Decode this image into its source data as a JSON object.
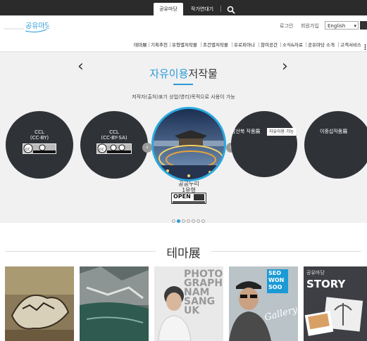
{
  "topbar": {
    "tabs": [
      {
        "label": "공유마당"
      },
      {
        "label": "작가연대기"
      }
    ]
  },
  "header": {
    "logo": {
      "text": "공유마당"
    },
    "util": {
      "login": "로그인",
      "signup": "회원가입",
      "language": "English"
    },
    "nav": [
      "테마展",
      "기획추천",
      "유형별저작물",
      "조건별저작물",
      "유로피아나",
      "참여공간",
      "소식&자료",
      "공유마당 소개",
      "고객서비스"
    ]
  },
  "hero": {
    "title_blue": "자유이용",
    "title_rest": "저작물",
    "subtitle": "저작자(출처)표기 상업(영리)목적으로 사용이 가능",
    "cards": [
      {
        "label_line1": "CCL",
        "label_line2": "(CC-BY)"
      },
      {
        "label_line1": "CCL",
        "label_line2": "(CC-BY-SA)"
      }
    ],
    "center": {
      "label_line1": "공공누리",
      "label_line2": "1유형",
      "badge": "OPEN"
    },
    "right_cards": [
      {
        "label": "남산북 작품展",
        "tag": "자유이용 가능"
      },
      {
        "label": "이중섭작품展"
      }
    ],
    "slide_count": 7,
    "active_slide": 1
  },
  "theme": {
    "title": "테마展",
    "thumbs": [
      {
        "alt": "painting"
      },
      {
        "alt": "landscape"
      },
      {
        "lines": [
          "PHOTO",
          "GRAPHER",
          "NAM",
          "SANG",
          "UK"
        ]
      },
      {
        "lines": [
          "SEO",
          "WON",
          "SOO"
        ],
        "script": "Gallery"
      },
      {
        "lines": [
          "공유마당",
          "STORY"
        ]
      }
    ]
  }
}
